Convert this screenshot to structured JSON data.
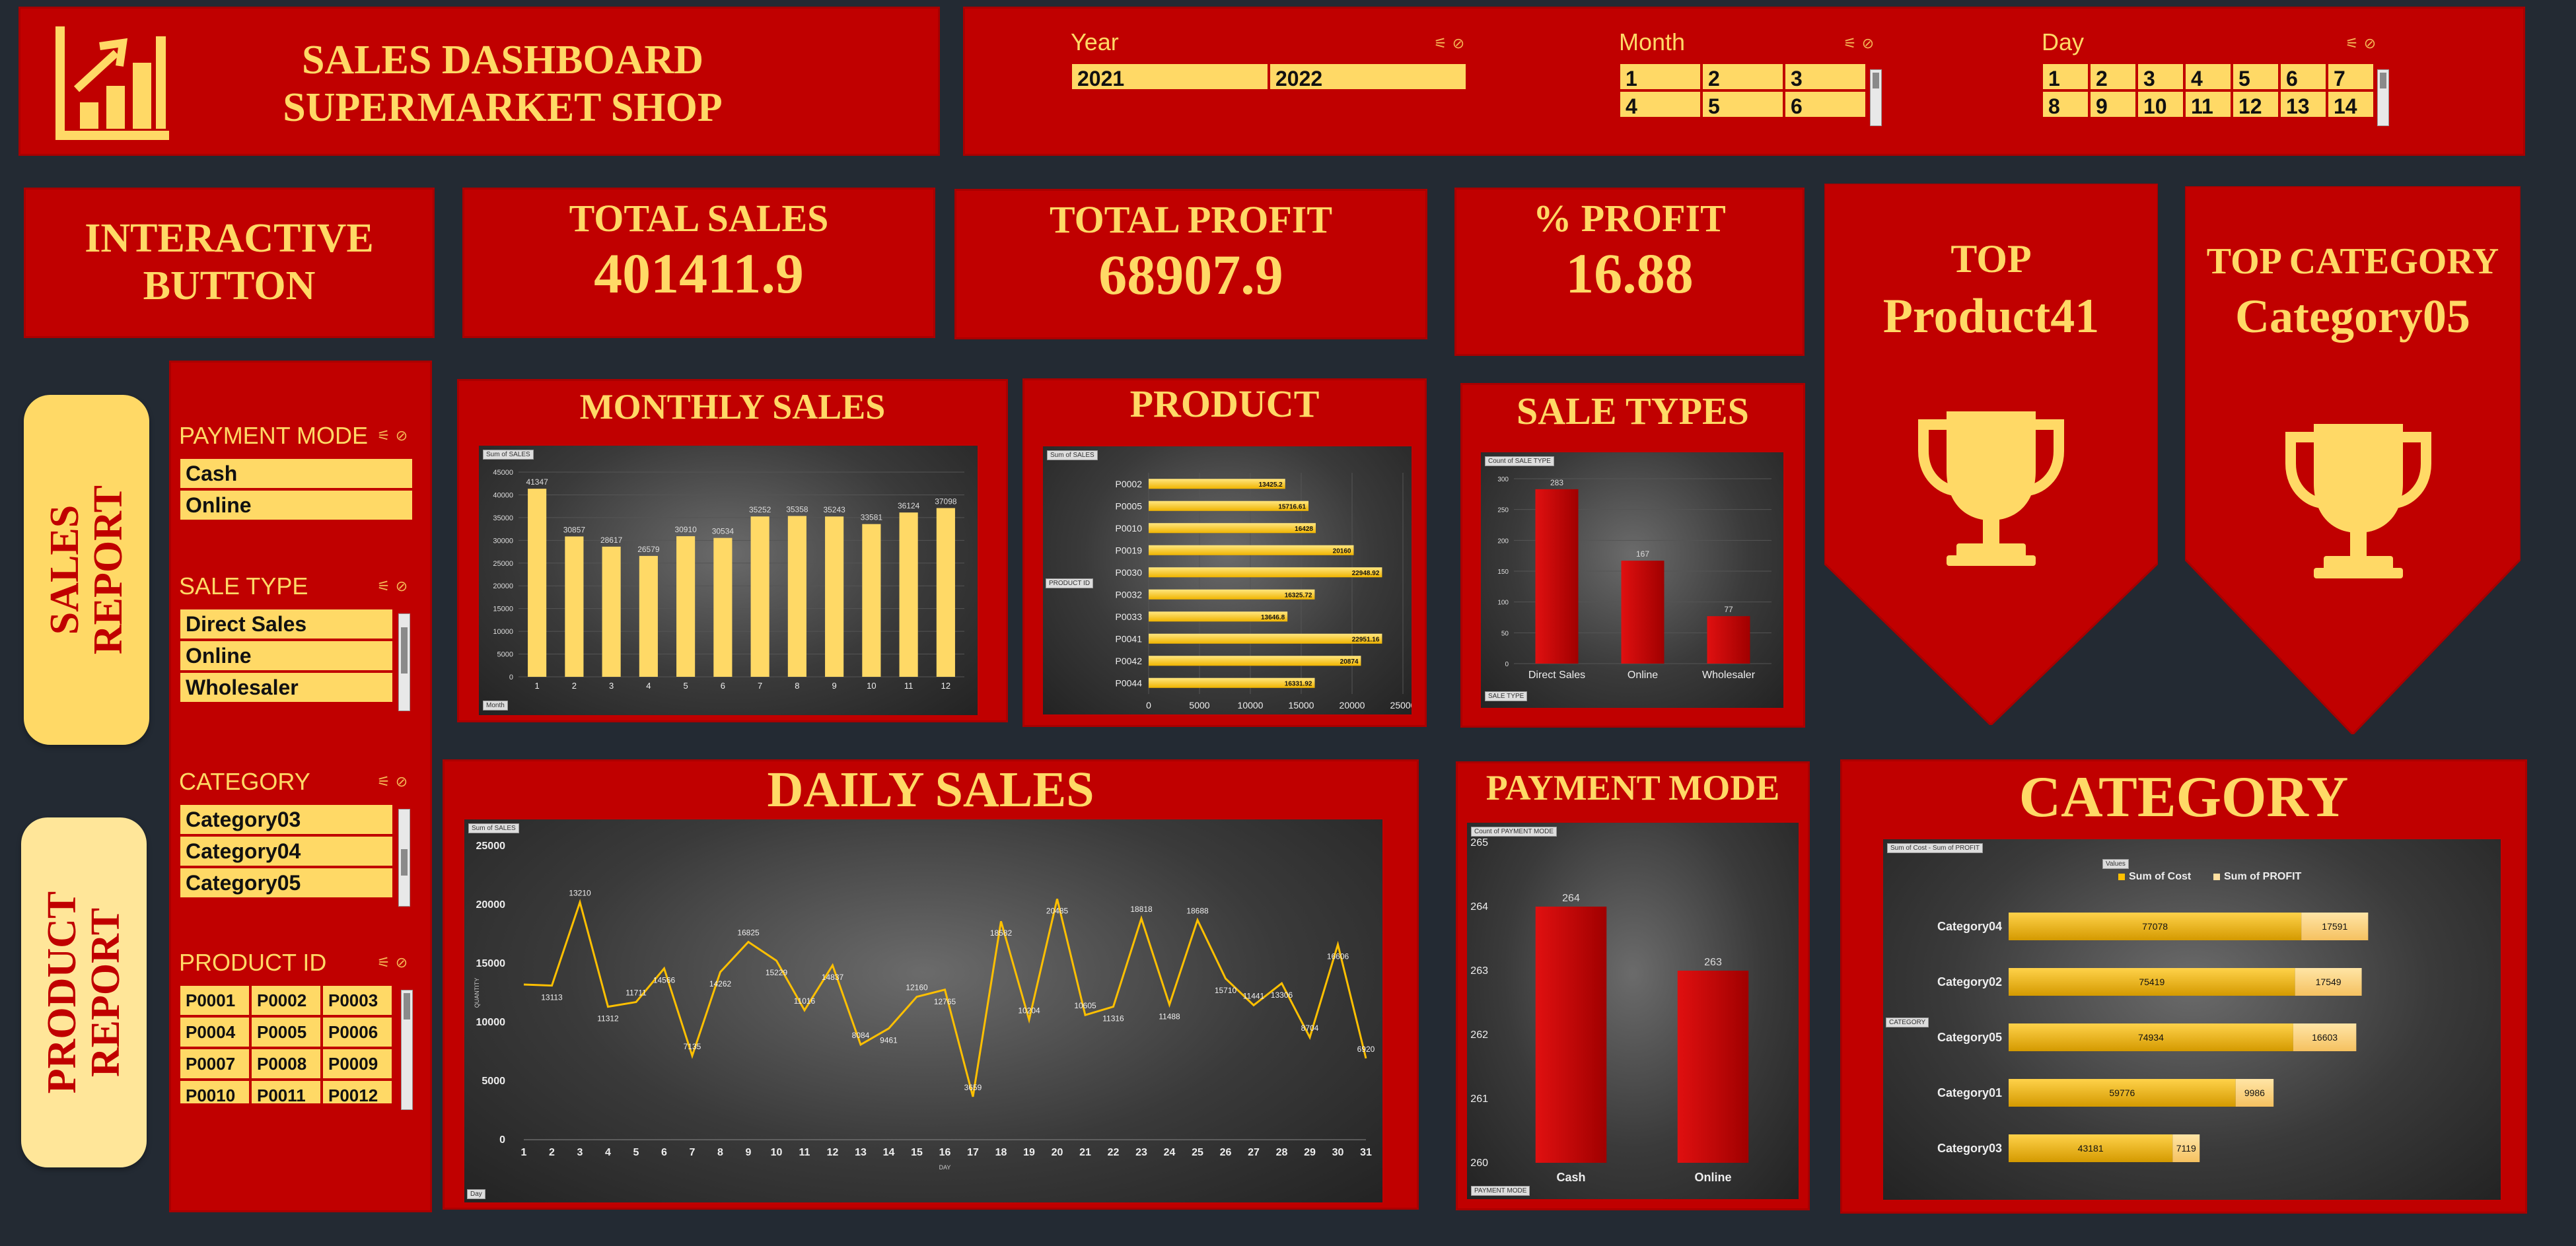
{
  "header": {
    "title_line1": "SALES DASHBOARD",
    "title_line2": "SUPERMARKET SHOP",
    "logo_icon": "bar-chart-growth-icon"
  },
  "filters": {
    "year": {
      "title": "Year",
      "items": [
        "2021",
        "2022"
      ]
    },
    "month": {
      "title": "Month",
      "items": [
        "1",
        "2",
        "3",
        "4",
        "5",
        "6"
      ]
    },
    "day": {
      "title": "Day",
      "items": [
        "1",
        "2",
        "3",
        "4",
        "5",
        "6",
        "7",
        "8",
        "9",
        "10",
        "11",
        "12",
        "13",
        "14"
      ]
    }
  },
  "kpis": {
    "interactive_line1": "INTERACTIVE",
    "interactive_line2": "BUTTON",
    "total_sales_label": "TOTAL SALES",
    "total_sales_value": "401411.9",
    "total_profit_label": "TOTAL PROFIT",
    "total_profit_value": "68907.9",
    "pct_profit_label": "% PROFIT",
    "pct_profit_value": "16.88",
    "top_label": "TOP",
    "top_value": "Product41",
    "top_category_label": "TOP CATEGORY",
    "top_category_value": "Category05",
    "trophy_icon": "trophy-icon"
  },
  "side_buttons": {
    "sales_report_line1": "SALES",
    "sales_report_line2": "REPORT",
    "product_report_line1": "PRODUCT",
    "product_report_line2": "REPORT"
  },
  "side_slicers": {
    "payment_mode": {
      "title": "PAYMENT MODE",
      "items": [
        "Cash",
        "Online"
      ]
    },
    "sale_type": {
      "title": "SALE TYPE",
      "items": [
        "Direct Sales",
        "Online",
        "Wholesaler"
      ]
    },
    "category": {
      "title": "CATEGORY",
      "items": [
        "Category03",
        "Category04",
        "Category05"
      ]
    },
    "product_id": {
      "title": "PRODUCT ID",
      "items": [
        "P0001",
        "P0002",
        "P0003",
        "P0004",
        "P0005",
        "P0006",
        "P0007",
        "P0008",
        "P0009",
        "P0010",
        "P0011",
        "P0012"
      ]
    }
  },
  "sections": {
    "monthly_sales": "MONTHLY SALES",
    "product": "PRODUCT",
    "sale_types": "SALE TYPES",
    "daily_sales": "DAILY SALES",
    "payment_mode": "PAYMENT MODE",
    "category": "CATEGORY"
  },
  "colors": {
    "panel_red": "#c00000",
    "gold": "#ffd966",
    "background": "#232a33"
  },
  "chart_data": [
    {
      "id": "monthly",
      "type": "bar",
      "field_tag": "Sum of SALES",
      "axis_tag": "Month",
      "categories": [
        "1",
        "2",
        "3",
        "4",
        "5",
        "6",
        "7",
        "8",
        "9",
        "10",
        "11",
        "12"
      ],
      "values": [
        41347,
        30857,
        28617,
        26579,
        30910,
        30534,
        35252,
        35358,
        35243,
        33581,
        36124,
        37098
      ],
      "ylim": [
        0,
        45000
      ],
      "yticks": [
        0,
        5000,
        10000,
        15000,
        20000,
        25000,
        30000,
        35000,
        40000,
        45000
      ]
    },
    {
      "id": "product",
      "type": "bar",
      "orientation": "horizontal",
      "field_tag": "Sum of SALES",
      "axis_tag": "PRODUCT ID",
      "categories": [
        "P0002",
        "P0005",
        "P0010",
        "P0019",
        "P0030",
        "P0032",
        "P0033",
        "P0041",
        "P0042",
        "P0044"
      ],
      "values": [
        13425.2,
        15716.61,
        16428,
        20160,
        22948.92,
        16325.72,
        13646.8,
        22951.16,
        20874,
        16331.92
      ],
      "labels": [
        "13425.2",
        "15716.61",
        "16428",
        "20160",
        "22948.92",
        "16325.72",
        "13646.8",
        "22951.16",
        "20874",
        "16331.92"
      ],
      "xlim": [
        0,
        25000
      ],
      "xticks": [
        0,
        5000,
        10000,
        15000,
        20000,
        25000
      ]
    },
    {
      "id": "sale_types",
      "type": "bar",
      "field_tag": "Count of SALE TYPE",
      "axis_tag": "SALE TYPE",
      "categories": [
        "Direct Sales",
        "Online",
        "Wholesaler"
      ],
      "values": [
        283,
        167,
        77
      ],
      "ylim": [
        0,
        300
      ],
      "yticks": [
        0,
        50,
        100,
        150,
        200,
        250,
        300
      ]
    },
    {
      "id": "daily",
      "type": "line",
      "field_tag": "Sum of SALES",
      "axis_tag": "Day",
      "ylabel": "QUANTITY",
      "xlabel": "DAY",
      "x": [
        "1",
        "2",
        "3",
        "4",
        "5",
        "6",
        "7",
        "8",
        "9",
        "10",
        "11",
        "12",
        "13",
        "14",
        "15",
        "16",
        "17",
        "18",
        "19",
        "20",
        "21",
        "22",
        "23",
        "24",
        "25",
        "26",
        "27",
        "28",
        "29",
        "30",
        "31"
      ],
      "values": [
        13200,
        13113,
        20202,
        11312,
        11711,
        14566,
        7135,
        14262,
        16825,
        15229,
        11016,
        14837,
        8084,
        9461,
        12160,
        12765,
        3659,
        18582,
        10204,
        20485,
        10605,
        11316,
        18818,
        11488,
        18688,
        13710,
        11441,
        13306,
        8704,
        16606,
        6920
      ],
      "labels": [
        "",
        "13113",
        "13210",
        "11312",
        "11711",
        "14566",
        "7135",
        "14262",
        "16825",
        "15229",
        "11016",
        "14837",
        "8084",
        "9461",
        "12160",
        "12765",
        "3659",
        "18582",
        "10204",
        "20485",
        "10605",
        "11316",
        "18818",
        "11488",
        "18688",
        "15710",
        "11441",
        "13306",
        "8704",
        "16606",
        "6920"
      ],
      "ylim": [
        0,
        25000
      ],
      "yticks": [
        0,
        5000,
        10000,
        15000,
        20000,
        25000
      ]
    },
    {
      "id": "payment",
      "type": "bar",
      "field_tag": "Count of PAYMENT MODE",
      "axis_tag": "PAYMENT MODE",
      "categories": [
        "Cash",
        "Online"
      ],
      "values": [
        264,
        263
      ],
      "ylim": [
        260,
        265
      ],
      "yticks": [
        260,
        261,
        262,
        263,
        264,
        265
      ]
    },
    {
      "id": "category",
      "type": "bar",
      "orientation": "horizontal",
      "stacked": true,
      "field_tag": "Sum of Cost - Sum of PROFIT",
      "axis_tag": "CATEGORY",
      "legend_tag": "Values",
      "legend": "top",
      "categories": [
        "Category04",
        "Category02",
        "Category05",
        "Category01",
        "Category03"
      ],
      "series": [
        {
          "name": "Sum of Cost",
          "values": [
            77078,
            75419,
            74934,
            59776,
            43181
          ]
        },
        {
          "name": "Sum of PROFIT",
          "values": [
            17591,
            17549,
            16603,
            9986,
            7119
          ]
        }
      ],
      "labels_cost": [
        "77078",
        "75419",
        "74934",
        "59776",
        "43181"
      ],
      "labels_profit": [
        "17591",
        "17549",
        "16603",
        "9986",
        "7119"
      ]
    }
  ]
}
